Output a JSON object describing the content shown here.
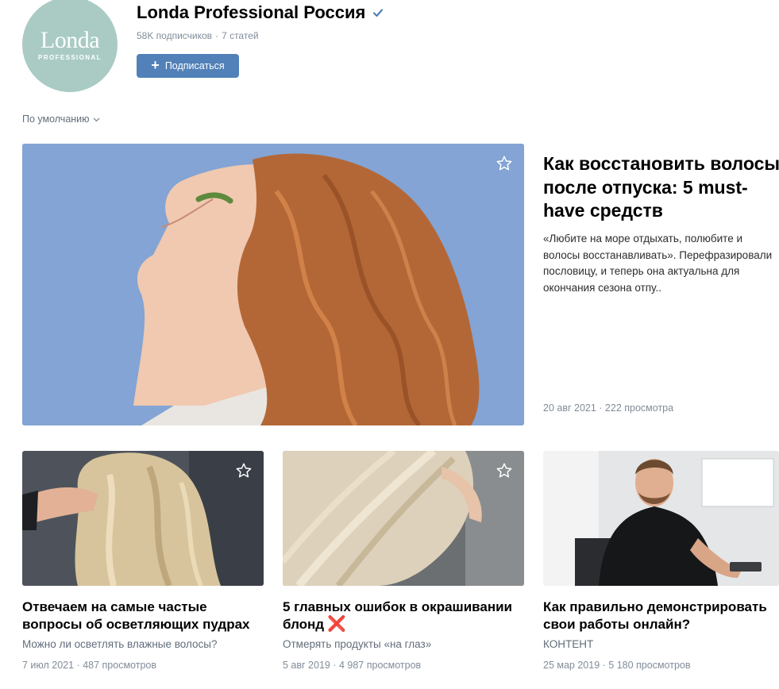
{
  "community": {
    "logo_word": "Londa",
    "logo_sub": "PROFESSIONAL",
    "name": "Londa Professional Россия",
    "subscribers": "58K подписчиков",
    "articles": "7 статей",
    "subscribe_label": "Подписаться",
    "verified_icon": "verified-check-icon"
  },
  "sort": {
    "label": "По умолчанию"
  },
  "featured": {
    "title_lines": [
      "Как восстановить волосы",
      "после отпуска: 5 must-",
      "have средств"
    ],
    "desc_lines": [
      "«Любите на море отдыхать, полюбите и",
      "волосы восстанавливать». Перефразировали",
      "пословицу, и теперь она актуальна для",
      "окончания сезона отпу.."
    ],
    "date": "20 авг 2021",
    "views": "222 просмотра"
  },
  "cards": [
    {
      "title_lines": [
        "Отвечаем на самые частые",
        "вопросы об осветляющих пудрах"
      ],
      "subtitle": "Можно ли осветлять влажные волосы?",
      "date": "7 июл 2021",
      "views": "487 просмотров"
    },
    {
      "title_lines": [
        "5 главных ошибок в окрашивании",
        "блонд"
      ],
      "title_emoji": "❌",
      "subtitle": "Отмерять продукты «на глаз»",
      "date": "5 авг 2019",
      "views": "4 987 просмотров"
    },
    {
      "title_lines": [
        "Как правильно демонстрировать",
        "свои работы онлайн?"
      ],
      "subtitle": "КОНТЕНТ",
      "date": "25 мар 2019",
      "views": "5 180 просмотров"
    }
  ],
  "colors": {
    "accent": "#5181b8",
    "logo_bg": "#a9cbc4",
    "meta": "#818c99",
    "featured_bg": "#86a7d6"
  }
}
